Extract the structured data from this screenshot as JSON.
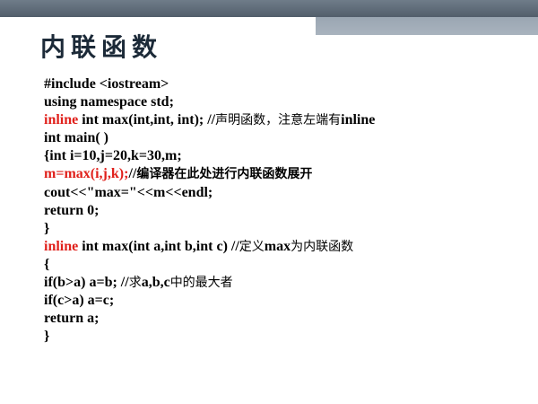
{
  "slide": {
    "title": "内联函数",
    "lines": [
      {
        "id": "include",
        "parts": [
          {
            "t": "#include <iostream>",
            "c": "plain"
          }
        ]
      },
      {
        "id": "using",
        "parts": [
          {
            "t": "using namespace std;",
            "c": "plain"
          }
        ]
      },
      {
        "id": "decl",
        "parts": [
          {
            "t": "inline",
            "c": "kw"
          },
          {
            "t": " int max(int,int, int); //",
            "c": "plain"
          },
          {
            "t": "声明函数，注意左端有",
            "c": "cm"
          },
          {
            "t": "inline",
            "c": "plain"
          }
        ]
      },
      {
        "id": "main",
        "parts": [
          {
            "t": "int main( )",
            "c": "plain"
          }
        ]
      },
      {
        "id": "vars",
        "parts": [
          {
            "t": "{int i=10,j=20,k=30,m;",
            "c": "plain"
          }
        ]
      },
      {
        "id": "call",
        "parts": [
          {
            "t": "m=max(i,j,k);",
            "c": "kw"
          },
          {
            "t": "//",
            "c": "plain"
          },
          {
            "t": "编译器在此处进行内联函数展开",
            "c": "cmb"
          }
        ]
      },
      {
        "id": "cout",
        "parts": [
          {
            "t": "cout<<\"max=\"<<m<<endl;",
            "c": "plain"
          }
        ]
      },
      {
        "id": "ret0",
        "parts": [
          {
            "t": "return 0;",
            "c": "plain"
          }
        ]
      },
      {
        "id": "close1",
        "parts": [
          {
            "t": "}",
            "c": "plain"
          }
        ]
      },
      {
        "id": "def",
        "parts": [
          {
            "t": "inline",
            "c": "kw"
          },
          {
            "t": " int max(int a,int b,int c) //",
            "c": "plain"
          },
          {
            "t": "定义",
            "c": "cm"
          },
          {
            "t": "max",
            "c": "plain"
          },
          {
            "t": "为内联函数",
            "c": "cm"
          }
        ]
      },
      {
        "id": "open2",
        "parts": [
          {
            "t": "{",
            "c": "plain"
          }
        ]
      },
      {
        "id": "if1",
        "parts": [
          {
            "t": "if(b>a) a=b; //",
            "c": "plain"
          },
          {
            "t": "求",
            "c": "cm"
          },
          {
            "t": "a,b,c",
            "c": "plain"
          },
          {
            "t": "中的最大者",
            "c": "cm"
          }
        ]
      },
      {
        "id": "if2",
        "parts": [
          {
            "t": "if(c>a) a=c;",
            "c": "plain"
          }
        ]
      },
      {
        "id": "reta",
        "parts": [
          {
            "t": "return a;",
            "c": "plain"
          }
        ]
      },
      {
        "id": "close2",
        "parts": [
          {
            "t": "}",
            "c": "plain"
          }
        ]
      }
    ]
  }
}
